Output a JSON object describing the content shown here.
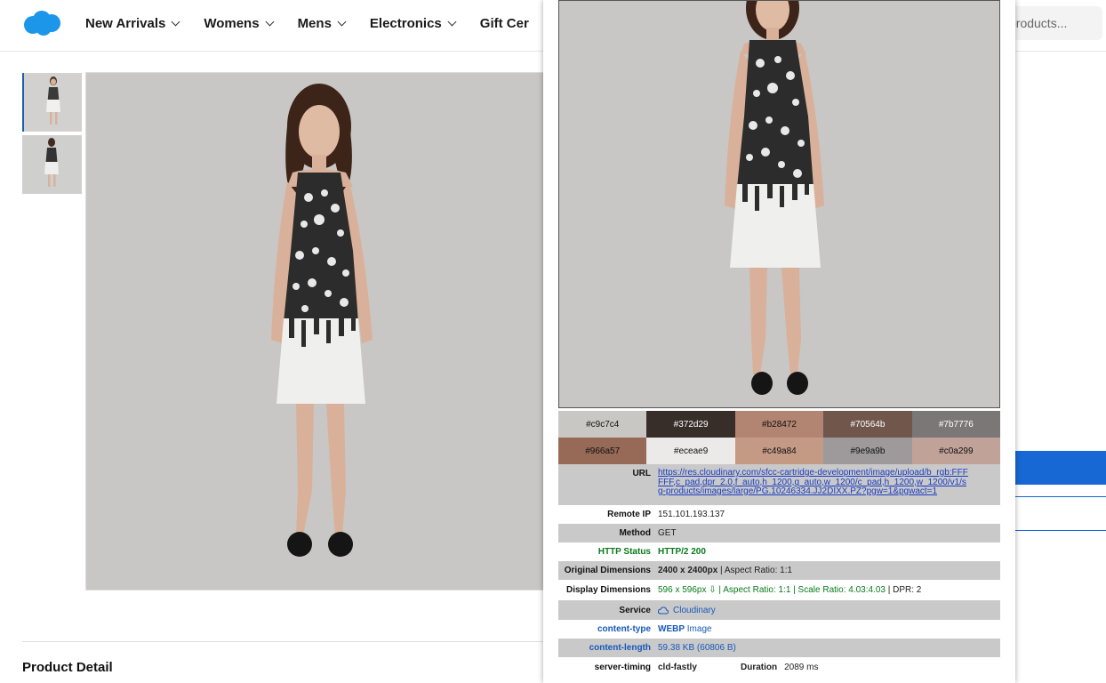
{
  "header": {
    "logo": "salesforce-cloud-logo",
    "nav": [
      {
        "label": "New Arrivals"
      },
      {
        "label": "Womens"
      },
      {
        "label": "Mens"
      },
      {
        "label": "Electronics"
      },
      {
        "label": "Gift Cer"
      }
    ],
    "search_placeholder": "products..."
  },
  "product": {
    "section_title": "Product Detail"
  },
  "inspector": {
    "swatches": [
      [
        {
          "hex": "#c9c7c4",
          "bg": "#c9c7c4",
          "fg": "#111111"
        },
        {
          "hex": "#372d29",
          "bg": "#372d29",
          "fg": "#ffffff"
        },
        {
          "hex": "#b28472",
          "bg": "#b28472",
          "fg": "#111111"
        },
        {
          "hex": "#70564b",
          "bg": "#70564b",
          "fg": "#ffffff"
        },
        {
          "hex": "#7b7776",
          "bg": "#7b7776",
          "fg": "#ffffff"
        }
      ],
      [
        {
          "hex": "#966a57",
          "bg": "#966a57",
          "fg": "#111111"
        },
        {
          "hex": "#eceae9",
          "bg": "#eceae9",
          "fg": "#111111"
        },
        {
          "hex": "#c49a84",
          "bg": "#c49a84",
          "fg": "#111111"
        },
        {
          "hex": "#9e9a9b",
          "bg": "#9e9a9b",
          "fg": "#111111"
        },
        {
          "hex": "#c0a299",
          "bg": "#c0a299",
          "fg": "#111111"
        }
      ]
    ],
    "url_label": "URL",
    "url_value": "https://res.cloudinary.com/sfcc-cartridge-development/image/upload/b_rgb:FFFFFF,c_pad,dpr_2.0,f_auto,h_1200,q_auto,w_1200/c_pad,h_1200,w_1200/v1/sg-products/images/large/PG.10246334.JJ2DIXX.PZ?pgw=1&pgwact=1",
    "url_lines": [
      "https://res.cloudinary.com/sfcc-cartridge-development/image/upload/b_rgb:FFF",
      "FFF,c_pad,dpr_2.0,f_auto,h_1200,q_auto,w_1200/c_pad,h_1200,w_1200/v1/s",
      "g-products/images/large/PG.10246334.JJ2DIXX.PZ?pgw=1&pgwact=1"
    ],
    "remote_ip_label": "Remote IP",
    "remote_ip": "151.101.193.137",
    "method_label": "Method",
    "method": "GET",
    "http_status_label": "HTTP Status",
    "http_status": "HTTP/2 200",
    "orig_dim_label": "Original Dimensions",
    "orig_dim": "2400 x 2400px",
    "orig_ratio": " | Aspect Ratio: 1:1",
    "disp_dim_label": "Display Dimensions",
    "disp_dim": "596 x 596px ⇩ | Aspect Ratio: 1:1 | Scale Ratio: 4.03:4.03",
    "disp_dpr": " | DPR: 2",
    "service_label": "Service",
    "service": "Cloudinary",
    "content_type_label": "content-type",
    "content_type_fmt": "WEBP",
    "content_type_rest": " Image",
    "content_length_label": "content-length",
    "content_length": "59.38 KB (60806 B)",
    "server_timing_label": "server-timing",
    "server_timing": "cld-fastly",
    "duration_label": "Duration",
    "duration": "2089 ms"
  },
  "colors": {
    "accent_blue": "#1768d4",
    "status_green": "#0a7a1b",
    "image_bg": "#c9c8c6"
  }
}
